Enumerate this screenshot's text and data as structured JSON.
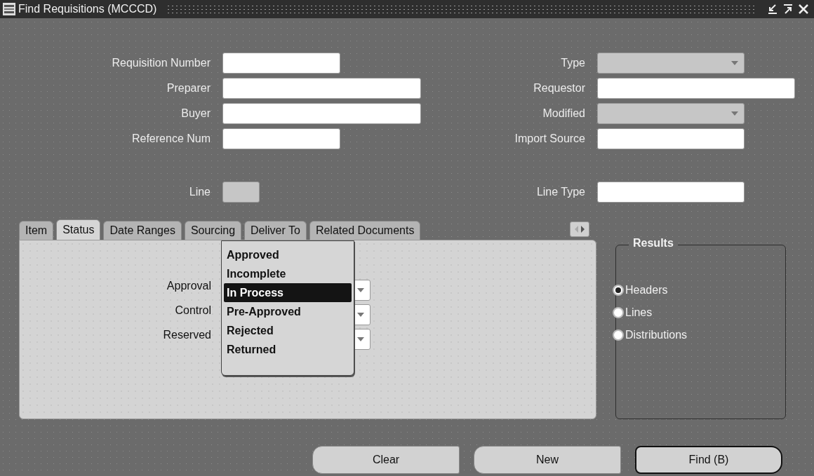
{
  "window": {
    "title": "Find Requisitions (MCCCD)"
  },
  "rows": [
    {
      "left": {
        "label": "Requisition Number",
        "kind": "text",
        "disabled": false
      },
      "right": {
        "label": "Type",
        "kind": "dropdown",
        "disabled": true
      }
    },
    {
      "left": {
        "label": "Preparer",
        "kind": "text",
        "disabled": false
      },
      "right": {
        "label": "Requestor",
        "kind": "text",
        "disabled": false
      }
    },
    {
      "left": {
        "label": "Buyer",
        "kind": "text",
        "disabled": false
      },
      "right": {
        "label": "Modified",
        "kind": "dropdown",
        "disabled": true
      }
    },
    {
      "left": {
        "label": "Reference Num",
        "kind": "text",
        "disabled": false
      },
      "right": {
        "label": "Import Source",
        "kind": "text",
        "disabled": false
      }
    }
  ],
  "line_row": {
    "left": {
      "label": "Line",
      "kind": "text",
      "disabled": true
    },
    "right": {
      "label": "Line Type",
      "kind": "text",
      "disabled": false
    }
  },
  "tabs": [
    {
      "label": "Item",
      "selected": false
    },
    {
      "label": "Status",
      "selected": true
    },
    {
      "label": "Date Ranges",
      "selected": false
    },
    {
      "label": "Sourcing",
      "selected": false
    },
    {
      "label": "Deliver To",
      "selected": false
    },
    {
      "label": "Related Documents",
      "selected": false
    }
  ],
  "status_fields": [
    {
      "label": "Approval"
    },
    {
      "label": "Control"
    },
    {
      "label": "Reserved"
    }
  ],
  "popup_list": [
    {
      "label": "Approved",
      "selected": false
    },
    {
      "label": "Incomplete",
      "selected": false
    },
    {
      "label": "In Process",
      "selected": true
    },
    {
      "label": "Pre-Approved",
      "selected": false
    },
    {
      "label": "Rejected",
      "selected": false
    },
    {
      "label": "Returned",
      "selected": false
    }
  ],
  "results": {
    "title": "Results",
    "options": [
      {
        "label": "Headers",
        "selected": true
      },
      {
        "label": "Lines",
        "selected": false
      },
      {
        "label": "Distributions",
        "selected": false
      }
    ]
  },
  "buttons": [
    {
      "label": "Clear",
      "default": false
    },
    {
      "label": "New",
      "default": false
    },
    {
      "label": "Find (B)",
      "default": true
    }
  ]
}
